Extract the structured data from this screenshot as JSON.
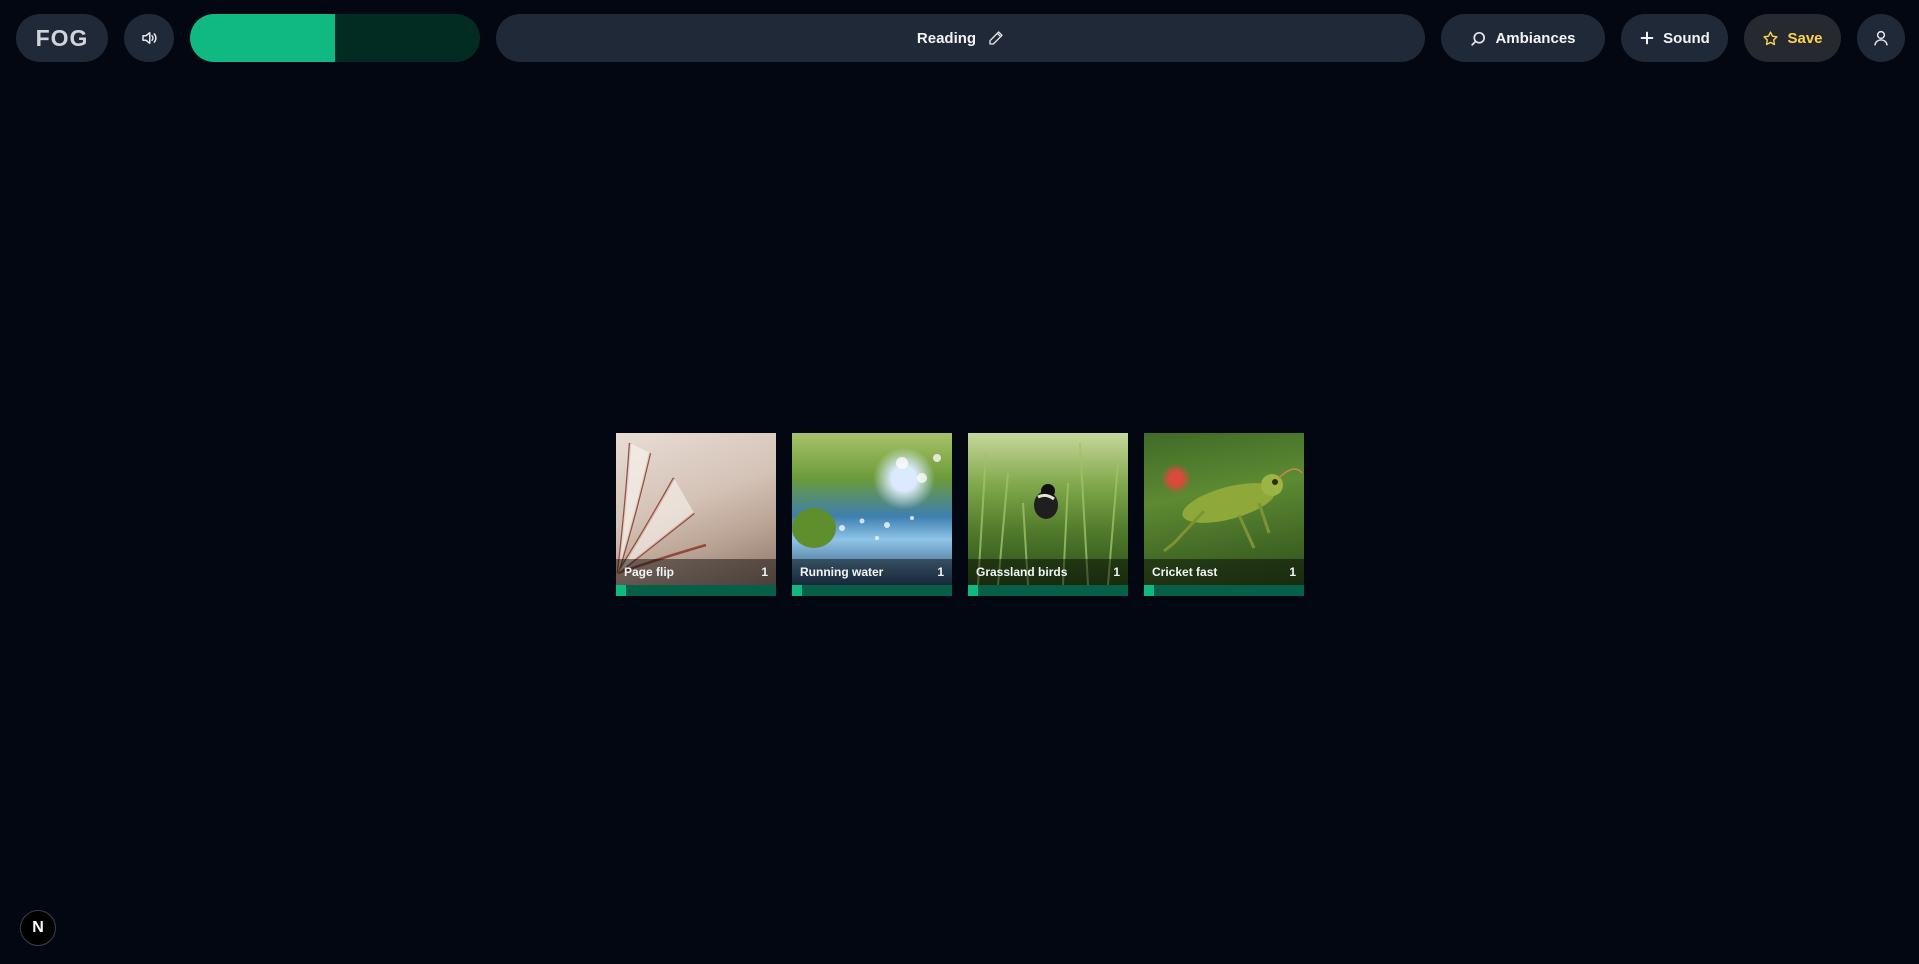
{
  "header": {
    "logo": "FOG",
    "title": "Reading",
    "ambiances_label": "Ambiances",
    "sound_label": "Sound",
    "save_label": "Save",
    "master_volume": 0.5
  },
  "icons": {
    "volume": "volume-icon",
    "edit": "pencil-icon",
    "search": "search-icon",
    "add": "plus-icon",
    "save": "star-icon",
    "user": "user-icon"
  },
  "sounds": [
    {
      "name": "Page flip",
      "count": "1",
      "volume": 0.06,
      "image": "book-pages"
    },
    {
      "name": "Running water",
      "count": "1",
      "volume": 0.06,
      "image": "stream"
    },
    {
      "name": "Grassland birds",
      "count": "1",
      "volume": 0.06,
      "image": "bird-in-grass"
    },
    {
      "name": "Cricket fast",
      "count": "1",
      "volume": 0.06,
      "image": "grasshopper"
    }
  ],
  "badge": "N",
  "colors": {
    "background": "#030712",
    "pill": "#1f2937",
    "accent": "#10b981",
    "accent_dark": "#065f46",
    "save": "#fcd34d"
  }
}
